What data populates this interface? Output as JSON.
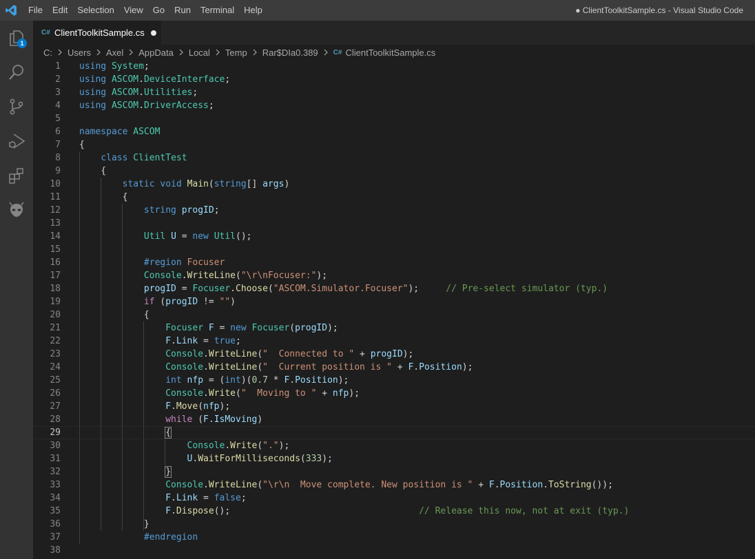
{
  "window": {
    "title": "● ClientToolkitSample.cs - Visual Studio Code",
    "menu": [
      "File",
      "Edit",
      "Selection",
      "View",
      "Go",
      "Run",
      "Terminal",
      "Help"
    ]
  },
  "activity_bar": {
    "items": [
      {
        "icon": "files-icon",
        "badge": "1"
      },
      {
        "icon": "search-icon"
      },
      {
        "icon": "source-control-icon"
      },
      {
        "icon": "run-debug-icon"
      },
      {
        "icon": "extensions-icon"
      },
      {
        "icon": "alien-extension-icon"
      }
    ]
  },
  "tab": {
    "icon_text": "C#",
    "label": "ClientToolkitSample.cs",
    "dirty": true
  },
  "breadcrumbs": {
    "parts": [
      "C:",
      "Users",
      "Axel",
      "AppData",
      "Local",
      "Temp",
      "Rar$DIa0.389"
    ],
    "file_icon": "C#",
    "file": "ClientToolkitSample.cs"
  },
  "editor": {
    "current_line": 29,
    "line_numbers": [
      "1",
      "2",
      "3",
      "4",
      "5",
      "6",
      "7",
      "8",
      "9",
      "10",
      "11",
      "12",
      "13",
      "14",
      "15",
      "16",
      "17",
      "18",
      "19",
      "20",
      "21",
      "22",
      "23",
      "24",
      "25",
      "26",
      "27",
      "28",
      "29",
      "30",
      "31",
      "32",
      "33",
      "34",
      "35",
      "36",
      "37",
      "38"
    ],
    "lines": [
      [
        [
          "kw",
          "using"
        ],
        [
          "pun",
          " "
        ],
        [
          "type",
          "System"
        ],
        [
          "pun",
          ";"
        ]
      ],
      [
        [
          "kw",
          "using"
        ],
        [
          "pun",
          " "
        ],
        [
          "type",
          "ASCOM"
        ],
        [
          "pun",
          "."
        ],
        [
          "type",
          "DeviceInterface"
        ],
        [
          "pun",
          ";"
        ]
      ],
      [
        [
          "kw",
          "using"
        ],
        [
          "pun",
          " "
        ],
        [
          "type",
          "ASCOM"
        ],
        [
          "pun",
          "."
        ],
        [
          "type",
          "Utilities"
        ],
        [
          "pun",
          ";"
        ]
      ],
      [
        [
          "kw",
          "using"
        ],
        [
          "pun",
          " "
        ],
        [
          "type",
          "ASCOM"
        ],
        [
          "pun",
          "."
        ],
        [
          "type",
          "DriverAccess"
        ],
        [
          "pun",
          ";"
        ]
      ],
      [],
      [
        [
          "kw",
          "namespace"
        ],
        [
          "pun",
          " "
        ],
        [
          "type",
          "ASCOM"
        ]
      ],
      [
        [
          "pun",
          "{"
        ]
      ],
      [
        [
          "pun",
          "    "
        ],
        [
          "kw",
          "class"
        ],
        [
          "pun",
          " "
        ],
        [
          "type",
          "ClientTest"
        ]
      ],
      [
        [
          "pun",
          "    {"
        ]
      ],
      [
        [
          "pun",
          "        "
        ],
        [
          "kw",
          "static"
        ],
        [
          "pun",
          " "
        ],
        [
          "kw",
          "void"
        ],
        [
          "pun",
          " "
        ],
        [
          "fn",
          "Main"
        ],
        [
          "pun",
          "("
        ],
        [
          "kw",
          "string"
        ],
        [
          "pun",
          "[] "
        ],
        [
          "var",
          "args"
        ],
        [
          "pun",
          ")"
        ]
      ],
      [
        [
          "pun",
          "        {"
        ]
      ],
      [
        [
          "pun",
          "            "
        ],
        [
          "kw",
          "string"
        ],
        [
          "pun",
          " "
        ],
        [
          "var",
          "progID"
        ],
        [
          "pun",
          ";"
        ]
      ],
      [],
      [
        [
          "pun",
          "            "
        ],
        [
          "type",
          "Util"
        ],
        [
          "pun",
          " "
        ],
        [
          "var",
          "U"
        ],
        [
          "pun",
          " = "
        ],
        [
          "kw",
          "new"
        ],
        [
          "pun",
          " "
        ],
        [
          "type",
          "Util"
        ],
        [
          "pun",
          "();"
        ]
      ],
      [],
      [
        [
          "pun",
          "            "
        ],
        [
          "pre",
          "#region"
        ],
        [
          "pun",
          " "
        ],
        [
          "str",
          "Focuser"
        ]
      ],
      [
        [
          "pun",
          "            "
        ],
        [
          "type",
          "Console"
        ],
        [
          "pun",
          "."
        ],
        [
          "fn",
          "WriteLine"
        ],
        [
          "pun",
          "("
        ],
        [
          "str",
          "\"\\r\\nFocuser:\""
        ],
        [
          "pun",
          ");"
        ]
      ],
      [
        [
          "pun",
          "            "
        ],
        [
          "var",
          "progID"
        ],
        [
          "pun",
          " = "
        ],
        [
          "type",
          "Focuser"
        ],
        [
          "pun",
          "."
        ],
        [
          "fn",
          "Choose"
        ],
        [
          "pun",
          "("
        ],
        [
          "str",
          "\"ASCOM.Simulator.Focuser\""
        ],
        [
          "pun",
          ");     "
        ],
        [
          "com",
          "// Pre-select simulator (typ.)"
        ]
      ],
      [
        [
          "pun",
          "            "
        ],
        [
          "ctl",
          "if"
        ],
        [
          "pun",
          " ("
        ],
        [
          "var",
          "progID"
        ],
        [
          "pun",
          " != "
        ],
        [
          "str",
          "\"\""
        ],
        [
          "pun",
          ")"
        ]
      ],
      [
        [
          "pun",
          "            {"
        ]
      ],
      [
        [
          "pun",
          "                "
        ],
        [
          "type",
          "Focuser"
        ],
        [
          "pun",
          " "
        ],
        [
          "var",
          "F"
        ],
        [
          "pun",
          " = "
        ],
        [
          "kw",
          "new"
        ],
        [
          "pun",
          " "
        ],
        [
          "type",
          "Focuser"
        ],
        [
          "pun",
          "("
        ],
        [
          "var",
          "progID"
        ],
        [
          "pun",
          ");"
        ]
      ],
      [
        [
          "pun",
          "                "
        ],
        [
          "var",
          "F"
        ],
        [
          "pun",
          "."
        ],
        [
          "var",
          "Link"
        ],
        [
          "pun",
          " = "
        ],
        [
          "kw",
          "true"
        ],
        [
          "pun",
          ";"
        ]
      ],
      [
        [
          "pun",
          "                "
        ],
        [
          "type",
          "Console"
        ],
        [
          "pun",
          "."
        ],
        [
          "fn",
          "WriteLine"
        ],
        [
          "pun",
          "("
        ],
        [
          "str",
          "\"  Connected to \""
        ],
        [
          "pun",
          " + "
        ],
        [
          "var",
          "progID"
        ],
        [
          "pun",
          ");"
        ]
      ],
      [
        [
          "pun",
          "                "
        ],
        [
          "type",
          "Console"
        ],
        [
          "pun",
          "."
        ],
        [
          "fn",
          "WriteLine"
        ],
        [
          "pun",
          "("
        ],
        [
          "str",
          "\"  Current position is \""
        ],
        [
          "pun",
          " + "
        ],
        [
          "var",
          "F"
        ],
        [
          "pun",
          "."
        ],
        [
          "var",
          "Position"
        ],
        [
          "pun",
          ");"
        ]
      ],
      [
        [
          "pun",
          "                "
        ],
        [
          "kw",
          "int"
        ],
        [
          "pun",
          " "
        ],
        [
          "var",
          "nfp"
        ],
        [
          "pun",
          " = ("
        ],
        [
          "kw",
          "int"
        ],
        [
          "pun",
          ")("
        ],
        [
          "num",
          "0.7"
        ],
        [
          "pun",
          " * "
        ],
        [
          "var",
          "F"
        ],
        [
          "pun",
          "."
        ],
        [
          "var",
          "Position"
        ],
        [
          "pun",
          ");"
        ]
      ],
      [
        [
          "pun",
          "                "
        ],
        [
          "type",
          "Console"
        ],
        [
          "pun",
          "."
        ],
        [
          "fn",
          "Write"
        ],
        [
          "pun",
          "("
        ],
        [
          "str",
          "\"  Moving to \""
        ],
        [
          "pun",
          " + "
        ],
        [
          "var",
          "nfp"
        ],
        [
          "pun",
          ");"
        ]
      ],
      [
        [
          "pun",
          "                "
        ],
        [
          "var",
          "F"
        ],
        [
          "pun",
          "."
        ],
        [
          "fn",
          "Move"
        ],
        [
          "pun",
          "("
        ],
        [
          "var",
          "nfp"
        ],
        [
          "pun",
          ");"
        ]
      ],
      [
        [
          "pun",
          "                "
        ],
        [
          "ctl",
          "while"
        ],
        [
          "pun",
          " ("
        ],
        [
          "var",
          "F"
        ],
        [
          "pun",
          "."
        ],
        [
          "var",
          "IsMoving"
        ],
        [
          "pun",
          ")"
        ]
      ],
      [
        [
          "pun",
          "                "
        ],
        [
          "box",
          "{"
        ]
      ],
      [
        [
          "pun",
          "                    "
        ],
        [
          "type",
          "Console"
        ],
        [
          "pun",
          "."
        ],
        [
          "fn",
          "Write"
        ],
        [
          "pun",
          "("
        ],
        [
          "str",
          "\".\""
        ],
        [
          "pun",
          ");"
        ]
      ],
      [
        [
          "pun",
          "                    "
        ],
        [
          "var",
          "U"
        ],
        [
          "pun",
          "."
        ],
        [
          "fn",
          "WaitForMilliseconds"
        ],
        [
          "pun",
          "("
        ],
        [
          "num",
          "333"
        ],
        [
          "pun",
          ");"
        ]
      ],
      [
        [
          "pun",
          "                "
        ],
        [
          "box",
          "}"
        ]
      ],
      [
        [
          "pun",
          "                "
        ],
        [
          "type",
          "Console"
        ],
        [
          "pun",
          "."
        ],
        [
          "fn",
          "WriteLine"
        ],
        [
          "pun",
          "("
        ],
        [
          "str",
          "\"\\r\\n  Move complete. New position is \""
        ],
        [
          "pun",
          " + "
        ],
        [
          "var",
          "F"
        ],
        [
          "pun",
          "."
        ],
        [
          "var",
          "Position"
        ],
        [
          "pun",
          "."
        ],
        [
          "fn",
          "ToString"
        ],
        [
          "pun",
          "());"
        ]
      ],
      [
        [
          "pun",
          "                "
        ],
        [
          "var",
          "F"
        ],
        [
          "pun",
          "."
        ],
        [
          "var",
          "Link"
        ],
        [
          "pun",
          " = "
        ],
        [
          "kw",
          "false"
        ],
        [
          "pun",
          ";"
        ]
      ],
      [
        [
          "pun",
          "                "
        ],
        [
          "var",
          "F"
        ],
        [
          "pun",
          "."
        ],
        [
          "fn",
          "Dispose"
        ],
        [
          "pun",
          "();                                   "
        ],
        [
          "com",
          "// Release this now, not at exit (typ.)"
        ]
      ],
      [
        [
          "pun",
          "            }"
        ]
      ],
      [
        [
          "pun",
          "            "
        ],
        [
          "pre",
          "#endregion"
        ]
      ],
      []
    ]
  },
  "colors": {
    "editor_bg": "#1e1e1e",
    "activity_bg": "#333333",
    "titlebar_bg": "#3c3c3c",
    "tabbar_bg": "#252526",
    "keyword": "#569cd6",
    "type": "#4ec9b0",
    "function": "#dcdcaa",
    "variable": "#9cdcfe",
    "string": "#ce9178",
    "comment": "#6a9955",
    "control": "#c586c0",
    "badge": "#007acc"
  }
}
